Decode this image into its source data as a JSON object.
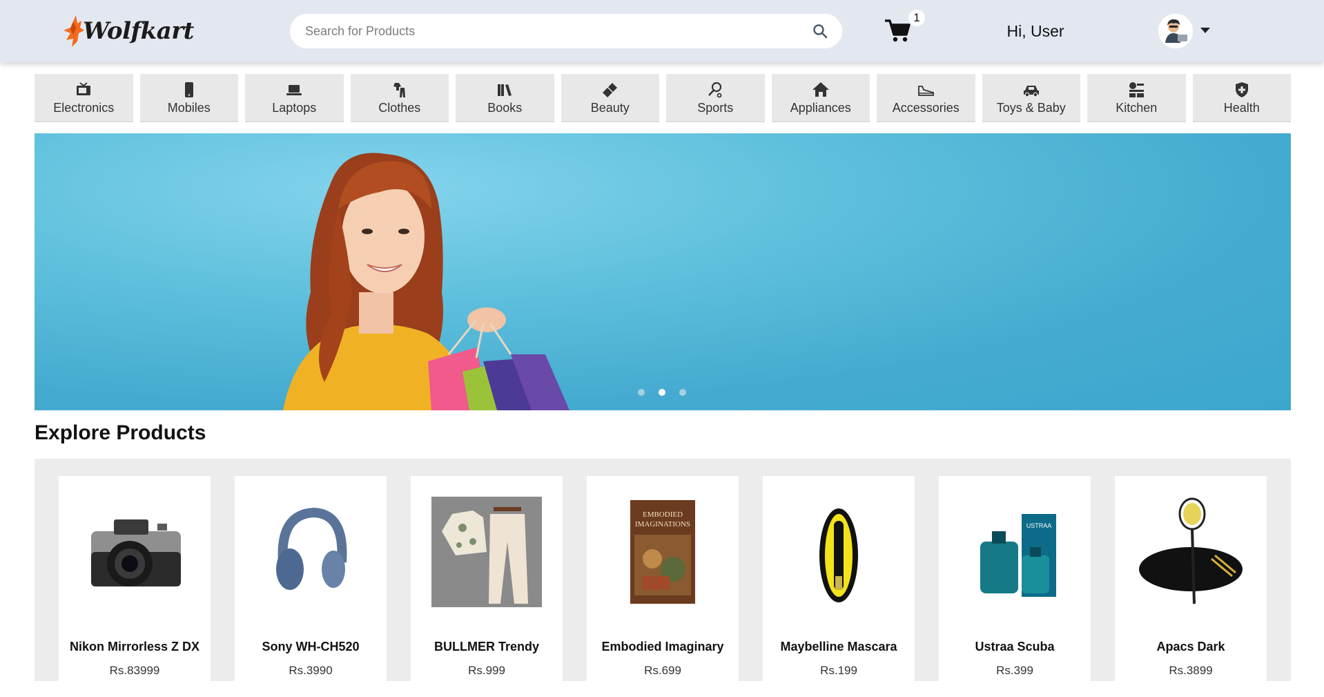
{
  "header": {
    "logo_text": "Wolfkart",
    "search_placeholder": "Search for Products",
    "cart_count": "1",
    "greeting": "Hi, User",
    "colors": {
      "bg": "#e3e8f0",
      "logo_orange": "#f36a1d"
    }
  },
  "categories": [
    {
      "label": "Electronics",
      "icon": "tv-icon"
    },
    {
      "label": "Mobiles",
      "icon": "mobile-phone-icon"
    },
    {
      "label": "Laptops",
      "icon": "laptop-icon"
    },
    {
      "label": "Clothes",
      "icon": "clothes-icon"
    },
    {
      "label": "Books",
      "icon": "books-icon"
    },
    {
      "label": "Beauty",
      "icon": "lipstick-icon"
    },
    {
      "label": "Sports",
      "icon": "racket-icon"
    },
    {
      "label": "Appliances",
      "icon": "home-icon"
    },
    {
      "label": "Accessories",
      "icon": "sneaker-icon"
    },
    {
      "label": "Toys & Baby",
      "icon": "toy-car-icon"
    },
    {
      "label": "Kitchen",
      "icon": "kitchen-icon"
    },
    {
      "label": "Health",
      "icon": "shield-plus-icon"
    }
  ],
  "banner": {
    "slide_count": 3,
    "active_slide": 2
  },
  "explore": {
    "title": "Explore Products",
    "products": [
      {
        "name": "Nikon Mirrorless Z DX",
        "price": "Rs.83999",
        "icon": "camera-image"
      },
      {
        "name": "Sony WH-CH520",
        "price": "Rs.3990",
        "icon": "headphones-image"
      },
      {
        "name": "BULLMER Trendy",
        "price": "Rs.999",
        "icon": "clothing-set-image"
      },
      {
        "name": "Embodied Imaginary",
        "price": "Rs.699",
        "icon": "book-cover-image"
      },
      {
        "name": "Maybelline Mascara",
        "price": "Rs.199",
        "icon": "mascara-image"
      },
      {
        "name": "Ustraa Scuba",
        "price": "Rs.399",
        "icon": "perfume-image"
      },
      {
        "name": "Apacs Dark",
        "price": "Rs.3899",
        "icon": "badminton-kit-image"
      }
    ]
  }
}
